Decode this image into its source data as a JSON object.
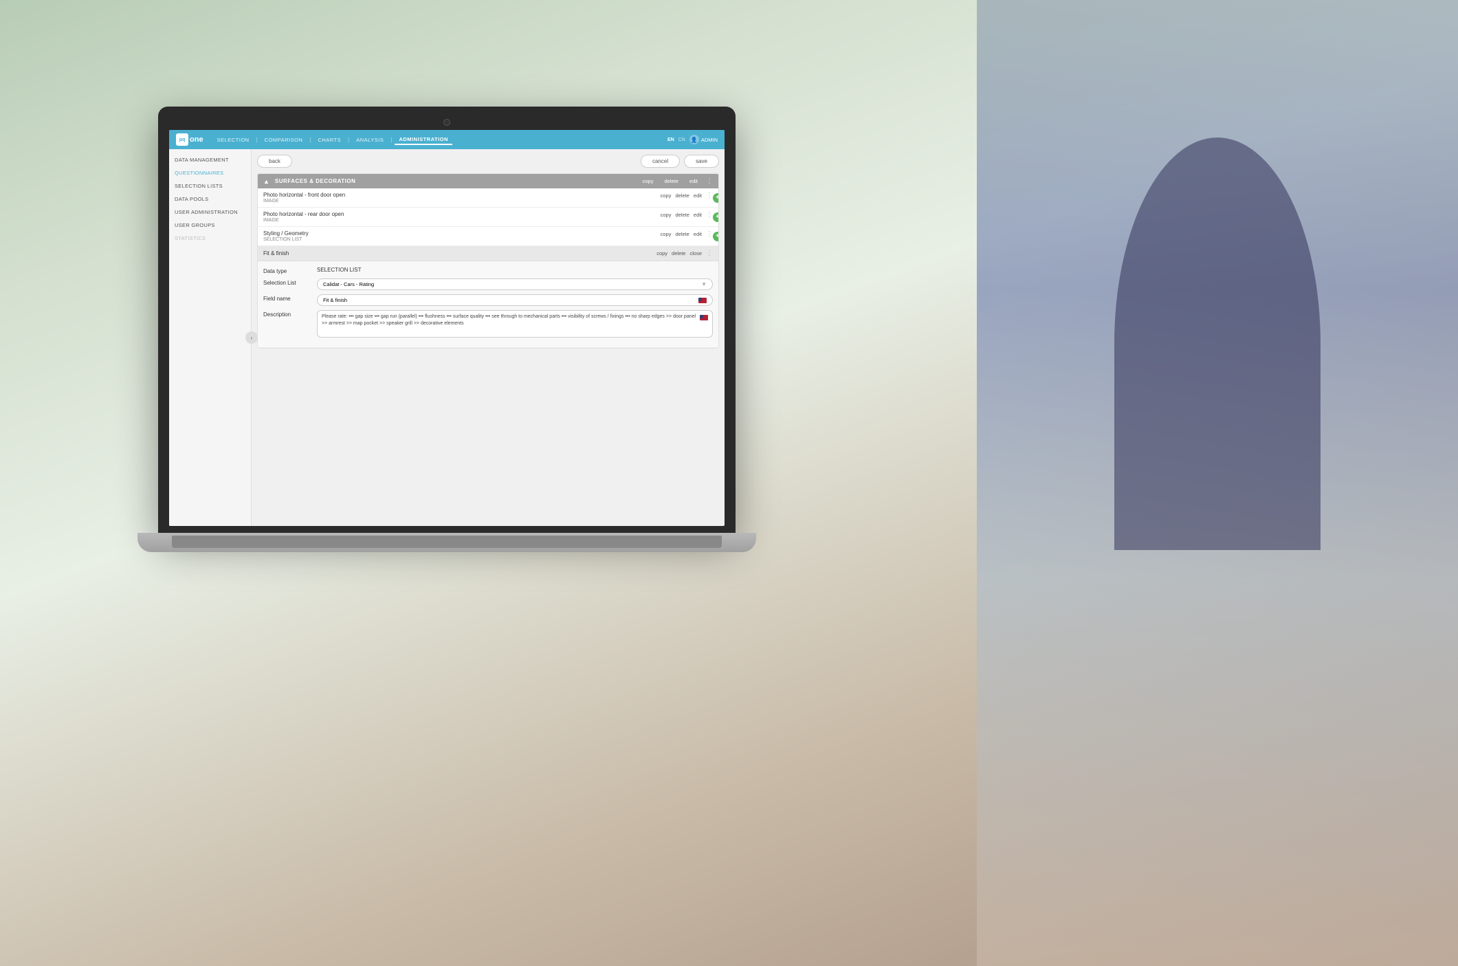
{
  "background": {
    "color": "#c0bdb8"
  },
  "nav": {
    "logo_text": "pq|one",
    "items": [
      {
        "label": "SELECTION",
        "active": false
      },
      {
        "label": "COMPARISON",
        "active": false
      },
      {
        "label": "CHARTS",
        "active": false
      },
      {
        "label": "ANALYSIS",
        "active": false
      },
      {
        "label": "ADMINISTRATION",
        "active": true
      }
    ],
    "lang_items": [
      {
        "label": "EN",
        "active": true
      },
      {
        "label": "CN",
        "active": false
      }
    ],
    "admin_label": "ADMIN"
  },
  "sidebar": {
    "items": [
      {
        "label": "DATA MANAGEMENT",
        "active": false
      },
      {
        "label": "QUESTIONNAIRES",
        "active": true
      },
      {
        "label": "SELECTION LISTS",
        "active": false
      },
      {
        "label": "DATA POOLS",
        "active": false
      },
      {
        "label": "USER ADMINISTRATION",
        "active": false
      },
      {
        "label": "USER GROUPS",
        "active": false
      },
      {
        "label": "STATISTICS",
        "active": false,
        "disabled": true
      }
    ]
  },
  "toolbar": {
    "back_label": "back",
    "cancel_label": "cancel",
    "save_label": "save"
  },
  "section": {
    "title": "SURFACES & DECORATION",
    "copy_label": "copy",
    "delete_label": "delete",
    "edit_label": "edit",
    "questions": [
      {
        "name": "Photo horizontal - front door open",
        "type": "IMAGE",
        "copy": "copy",
        "delete": "delete",
        "edit": "edit"
      },
      {
        "name": "Photo horizontal - rear door open",
        "type": "IMAGE",
        "copy": "copy",
        "delete": "delete",
        "edit": "edit"
      },
      {
        "name": "Styling / Geometry",
        "type": "SELECTION LIST",
        "copy": "copy",
        "delete": "delete",
        "edit": "edit"
      },
      {
        "name": "Fit & finish",
        "type": "",
        "copy": "copy",
        "delete": "delete",
        "close": "close",
        "expanded": true
      }
    ]
  },
  "expanded_form": {
    "data_type_label": "Data type",
    "data_type_value": "SELECTION LIST",
    "selection_list_label": "Selection List",
    "selection_list_value": "Calidat - Cars - Rating",
    "field_name_label": "Field name",
    "field_name_value": "Fit & finish",
    "description_label": "Description",
    "description_value": "Please rate: ••• gap size ••• gap run (parallel) ••• flushness ••• surface quality ••• see through to mechanical parts ••• visibility of screws / fixings ••• no sharp edges >> door panel >> armrest >> map pocket >> speaker grill >> decorative elements"
  }
}
